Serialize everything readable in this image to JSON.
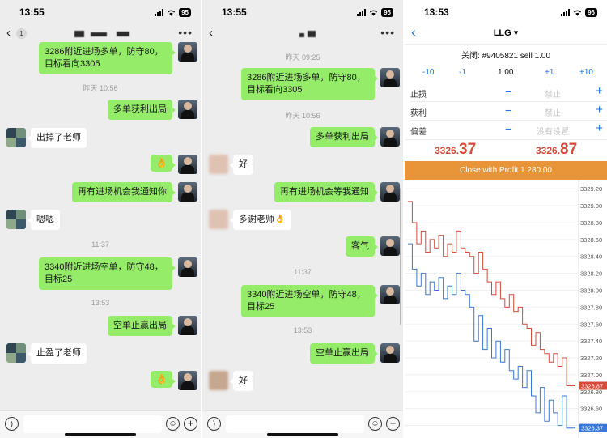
{
  "status": {
    "left_time": "13:55",
    "middle_time": "13:55",
    "right_time": "13:53",
    "left_battery": "95",
    "middle_battery": "95",
    "right_battery": "96"
  },
  "chat1": {
    "unread_badge": "1",
    "messages": [
      {
        "text": "3286附近进场多单，防守80，目标看向3305"
      },
      {
        "text": "昨天 10:56"
      },
      {
        "text": "多单获利出局"
      },
      {
        "text": "出掉了老师"
      },
      {
        "text": "👌"
      },
      {
        "text": "再有进场机会我通知你"
      },
      {
        "text": "嗯嗯"
      },
      {
        "text": "11:37"
      },
      {
        "text": "3340附近进场空单，防守48，目标25"
      },
      {
        "text": "13:53"
      },
      {
        "text": "空单止赢出局"
      },
      {
        "text": "止盈了老师"
      },
      {
        "text": "👌"
      }
    ]
  },
  "chat2": {
    "messages": [
      {
        "text": "昨天 09:25"
      },
      {
        "text": "3286附近进场多单，防守80，目标看向3305"
      },
      {
        "text": "昨天 10:56"
      },
      {
        "text": "多单获利出局"
      },
      {
        "text": "好"
      },
      {
        "text": "再有进场机会等我通知"
      },
      {
        "text": "多谢老师👌"
      },
      {
        "text": "客气"
      },
      {
        "text": "11:37"
      },
      {
        "text": "3340附近进场空单，防守48，目标25"
      },
      {
        "text": "13:53"
      },
      {
        "text": "空单止赢出局"
      },
      {
        "text": "好"
      }
    ]
  },
  "trade": {
    "symbol": "LLG ▾",
    "close_label": "关闭: #9405821 sell 1.00",
    "volume_steps": [
      "-10",
      "-1",
      "1.00",
      "+1",
      "+10"
    ],
    "params": [
      {
        "label": "止损",
        "value": "禁止"
      },
      {
        "label": "获利",
        "value": "禁止"
      },
      {
        "label": "偏差",
        "value": "没有设置"
      }
    ],
    "bid_main": "3326.",
    "bid_big": "37",
    "ask_main": "3326.",
    "ask_big": "87",
    "close_button": "Close with Profit 1 280.00",
    "accent_red": "#d64b3b",
    "accent_blue": "#1a73e8",
    "button_orange": "#e8953a"
  },
  "chart_data": {
    "type": "line",
    "y_ticks": [
      "3329.20",
      "3329.00",
      "3328.80",
      "3328.60",
      "3328.40",
      "3328.20",
      "3328.00",
      "3327.80",
      "3327.60",
      "3327.40",
      "3327.20",
      "3327.00",
      "3326.80",
      "3326.60",
      "3326.40"
    ],
    "ylim": [
      3326.3,
      3329.25
    ],
    "series": [
      {
        "color": "#d64b3b",
        "last_label": "3326.87",
        "values": [
          3329.05,
          3328.8,
          3328.55,
          3328.7,
          3328.45,
          3328.6,
          3328.5,
          3328.65,
          3328.4,
          3328.55,
          3328.45,
          3328.7,
          3328.5,
          3328.45,
          3328.4,
          3328.2,
          3328.45,
          3328.25,
          3328.1,
          3327.95,
          3328.1,
          3327.9,
          3327.8,
          3327.95,
          3327.75,
          3327.8,
          3327.6,
          3327.55,
          3327.35,
          3327.5,
          3327.3,
          3327.25,
          3327.15,
          3327.25,
          3327.1,
          3327.2,
          3326.87,
          3326.87,
          3326.87
        ]
      },
      {
        "color": "#3a78d8",
        "last_label": "3326.37",
        "values": [
          3328.55,
          3328.25,
          3328.05,
          3328.2,
          3327.95,
          3328.1,
          3328.0,
          3328.15,
          3327.9,
          3328.05,
          3327.95,
          3328.2,
          3328.0,
          3327.95,
          3327.8,
          3327.4,
          3327.7,
          3327.3,
          3327.55,
          3327.2,
          3327.4,
          3327.15,
          3327.3,
          3327.05,
          3326.95,
          3327.1,
          3326.85,
          3327.05,
          3326.75,
          3326.55,
          3326.85,
          3326.45,
          3326.7,
          3326.55,
          3326.4,
          3326.75,
          3326.37,
          3326.37,
          3326.37
        ]
      }
    ]
  }
}
